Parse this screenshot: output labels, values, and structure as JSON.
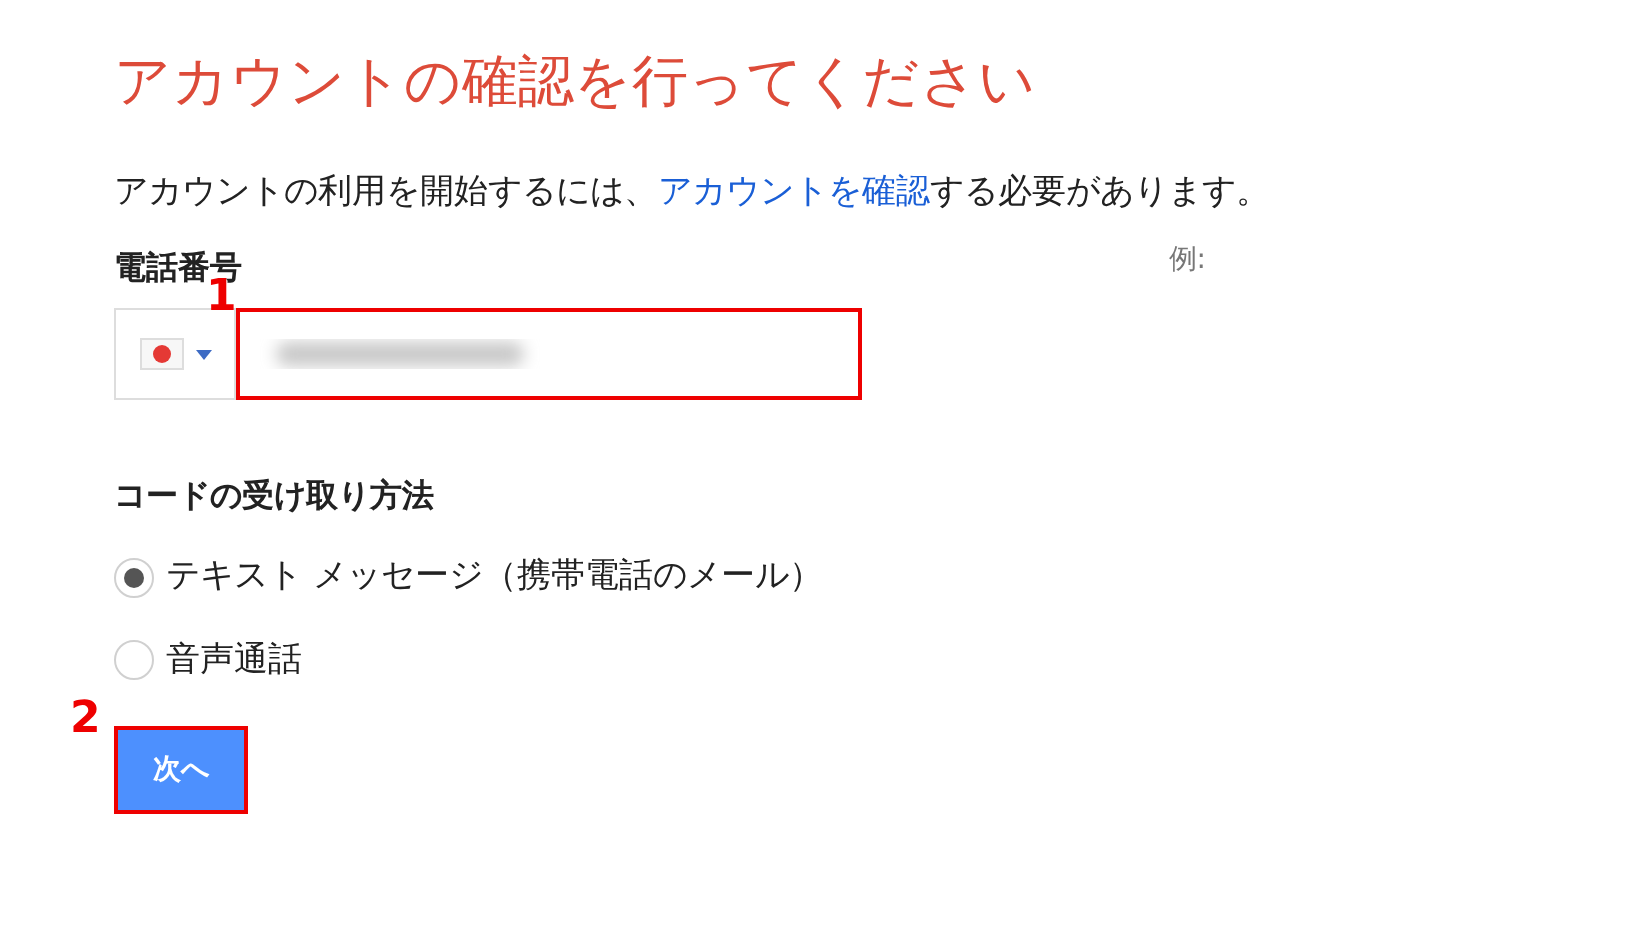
{
  "title": "アカウントの確認を行ってください",
  "intro": {
    "before": "アカウントの利用を開始するには、",
    "link": "アカウントを確認",
    "after": "する必要があります。"
  },
  "phone": {
    "label": "電話番号",
    "example_label": "例:",
    "value_blurred": true,
    "highlighted": true,
    "callout": "1"
  },
  "method": {
    "label": "コードの受け取り方法",
    "options": [
      {
        "label": "テキスト メッセージ（携帯電話のメール）",
        "selected": true
      },
      {
        "label": "音声通話",
        "selected": false
      }
    ]
  },
  "next_button": {
    "label": "次へ",
    "highlighted": true,
    "callout": "2"
  }
}
